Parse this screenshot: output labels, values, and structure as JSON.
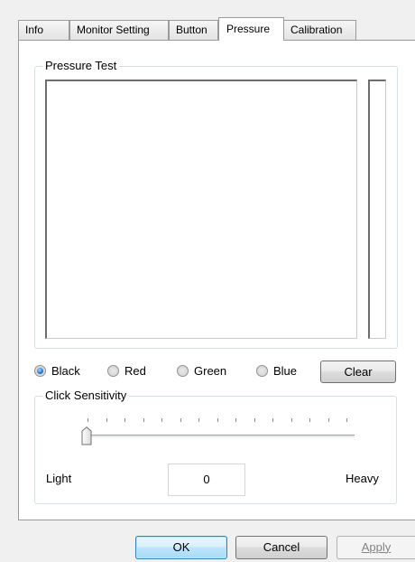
{
  "tabs": [
    {
      "label": "Info"
    },
    {
      "label": "Monitor Setting"
    },
    {
      "label": "Button"
    },
    {
      "label": "Pressure",
      "active": true
    },
    {
      "label": "Calibration"
    }
  ],
  "pressure_test": {
    "group_title": "Pressure Test",
    "pressure_bar_level": 0
  },
  "colors": {
    "options": [
      "Black",
      "Red",
      "Green",
      "Blue"
    ],
    "selected": "Black",
    "clear_label": "Clear"
  },
  "click_sensitivity": {
    "group_title": "Click Sensitivity",
    "min_label": "Light",
    "max_label": "Heavy",
    "value": "0",
    "tick_count": 15
  },
  "footer": {
    "ok_label": "OK",
    "cancel_label": "Cancel",
    "apply_label": "Apply"
  }
}
